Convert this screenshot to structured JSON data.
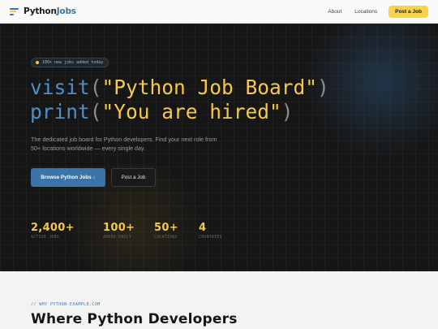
{
  "header": {
    "logo_prefix": "Python",
    "logo_accent": "Jobs",
    "nav": [
      "About",
      "Locations"
    ],
    "cta_label": "Post a Job"
  },
  "hero": {
    "badge": "100+ new jobs added today",
    "line1": {
      "fn": "visit",
      "open": "(",
      "str": "\"Python Job Board\"",
      "close": ")"
    },
    "line2": {
      "fn": "print",
      "open": "(",
      "str": "\"You are hired\"",
      "close": ")"
    },
    "description": "The dedicated job board for Python developers. Find your next role from 50+ locations worldwide — every single day.",
    "primary_button": "Browse Python Jobs ↓",
    "secondary_button": "Post a Job",
    "stats": [
      {
        "value": "2,400+",
        "label": "ACTIVE JOBS"
      },
      {
        "value": "100+",
        "label": "ADDED DAILY"
      },
      {
        "value": "50+",
        "label": "LOCATIONS"
      },
      {
        "value": "4",
        "label": "COUNTRIES"
      }
    ]
  },
  "why": {
    "eyebrow": "// WHY PYTHON-EXAMPLE.COM",
    "title": "Where Python Developers"
  },
  "colors": {
    "accent_blue": "#3c74a8",
    "accent_yellow": "#f7d24a",
    "hero_bg": "#161616",
    "section_bg": "#f3f3f1"
  },
  "icons": [
    "logo-bars-icon",
    "badge-dot-icon",
    "arrow-down-icon"
  ]
}
